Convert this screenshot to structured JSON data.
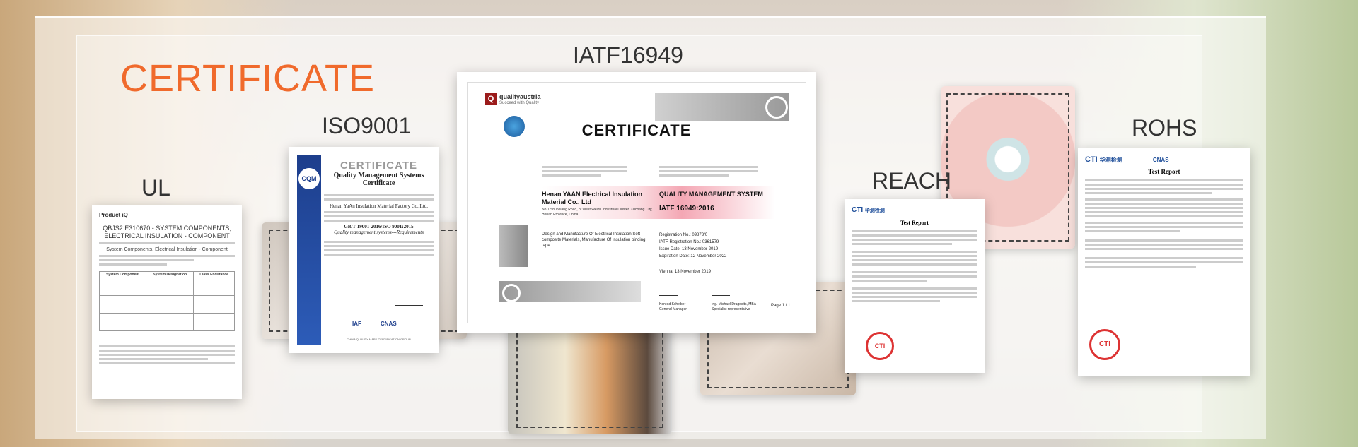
{
  "heading": "CERTIFICATE",
  "labels": {
    "ul": "UL",
    "iso": "ISO9001",
    "iatf": "IATF16949",
    "reach": "REACH",
    "rohs": "ROHS"
  },
  "ul_doc": {
    "brand": "Product iQ",
    "title": "QBJS2.E310670 - SYSTEM COMPONENTS, ELECTRICAL INSULATION - COMPONENT",
    "subtitle": "System Components, Electrical Insulation - Component",
    "col1": "System Component",
    "col2": "System Designation",
    "col3": "Class Endurance"
  },
  "iso_doc": {
    "title": "CERTIFICATE",
    "subtitle": "Quality Management Systems Certificate",
    "company": "Henan YaAn Insulation Material Factory Co.,Ltd.",
    "standard": "GB/T 19001-2016/ISO 9001:2015",
    "requirement": "Quality management systems---Requirements",
    "logo": "CQM",
    "badge1": "IAF",
    "badge2": "CNAS",
    "footer": "CHINA QUALITY MARK CERTIFICATION GROUP"
  },
  "iatf_doc": {
    "brand": "qualityaustria",
    "tagline": "Succeed with Quality",
    "title": "CERTIFICATE",
    "company": "Henan YAAN Electrical Insulation Material Co., Ltd",
    "address": "No.1 Shuneiang Road, of West Weidu Industrial Cluster, Xuchang City, Henan Province, China",
    "system": "QUALITY MANAGEMENT SYSTEM",
    "standard": "IATF 16949:2016",
    "registration": "Registration No.: 09873/0",
    "iatf_reg": "IATF-Registration No.: 0361579",
    "issue": "Issue Date: 13 November 2019",
    "expiry": "Expiration Date: 12 November 2022",
    "place": "Vienna, 13 November 2019",
    "scope": "Design and Manufacture Of Electrical Insulation Soft composite Materials, Manufacture Of Insulation binding tape",
    "sig1": "Konrad Scheiber",
    "sig1_role": "General Manager",
    "sig2": "Ing. Michael Dragosits, MBA",
    "sig2_role": "Specialist representative",
    "page": "Page 1 / 1"
  },
  "reach_doc": {
    "brand": "CTI",
    "brand_cn": "华测检测",
    "title": "Test Report",
    "stamp": "CTI"
  },
  "rohs_doc": {
    "brand": "CTI",
    "brand_cn": "华测检测",
    "title": "Test Report",
    "badge": "CNAS",
    "stamp": "CTI"
  }
}
